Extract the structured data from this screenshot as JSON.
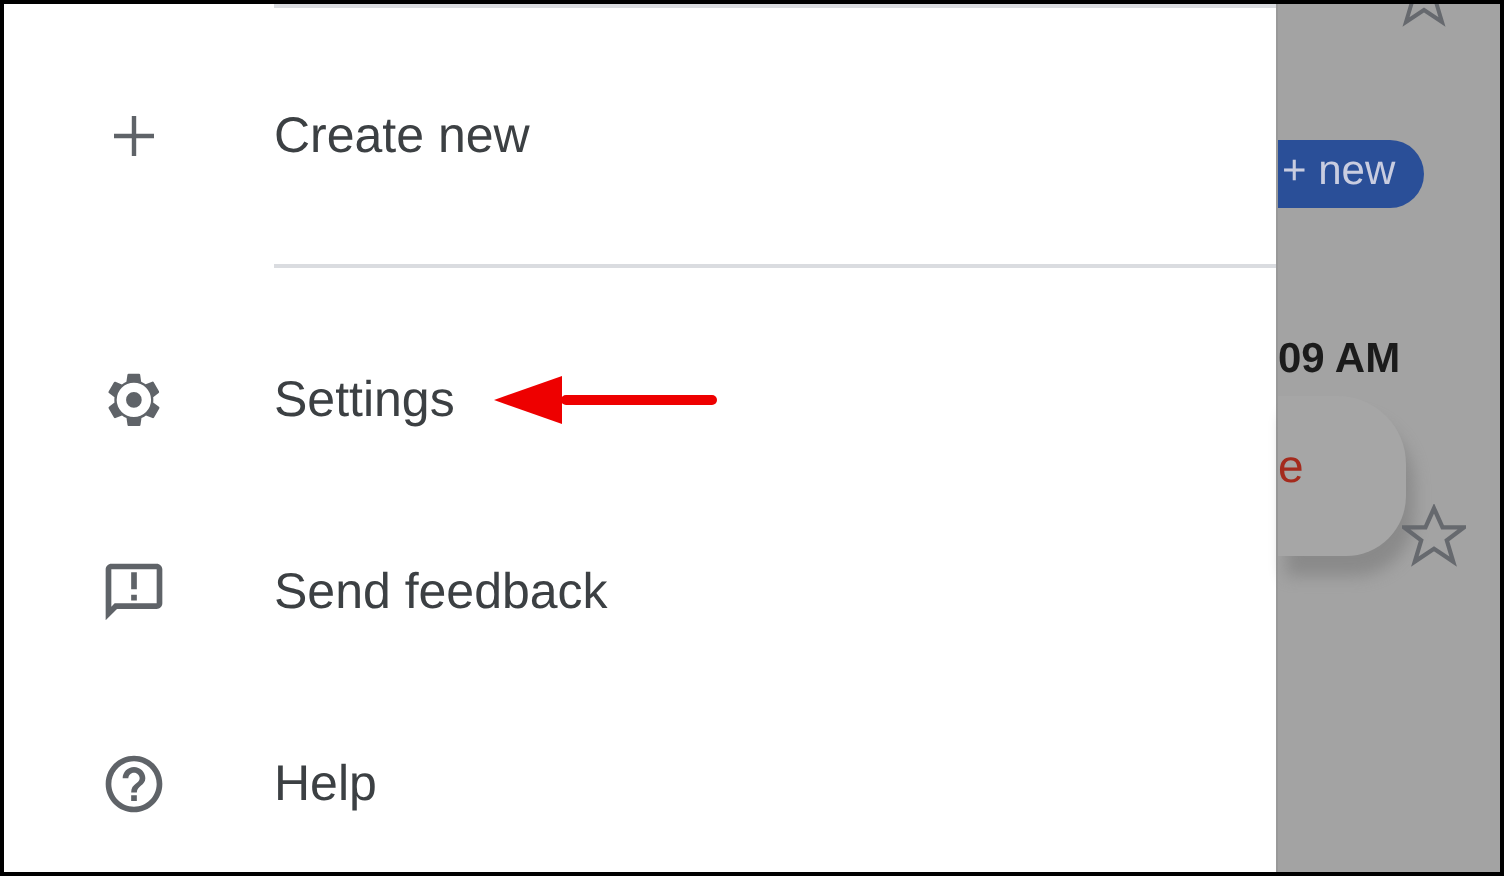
{
  "drawer": {
    "items": [
      {
        "label": "Create new",
        "kind": "plus"
      },
      {
        "label": "Settings",
        "kind": "gear"
      },
      {
        "label": "Send feedback",
        "kind": "feedback"
      },
      {
        "label": "Help",
        "kind": "help"
      }
    ]
  },
  "background": {
    "new_button": "+ new",
    "time": "09 AM",
    "snippet": "e"
  }
}
